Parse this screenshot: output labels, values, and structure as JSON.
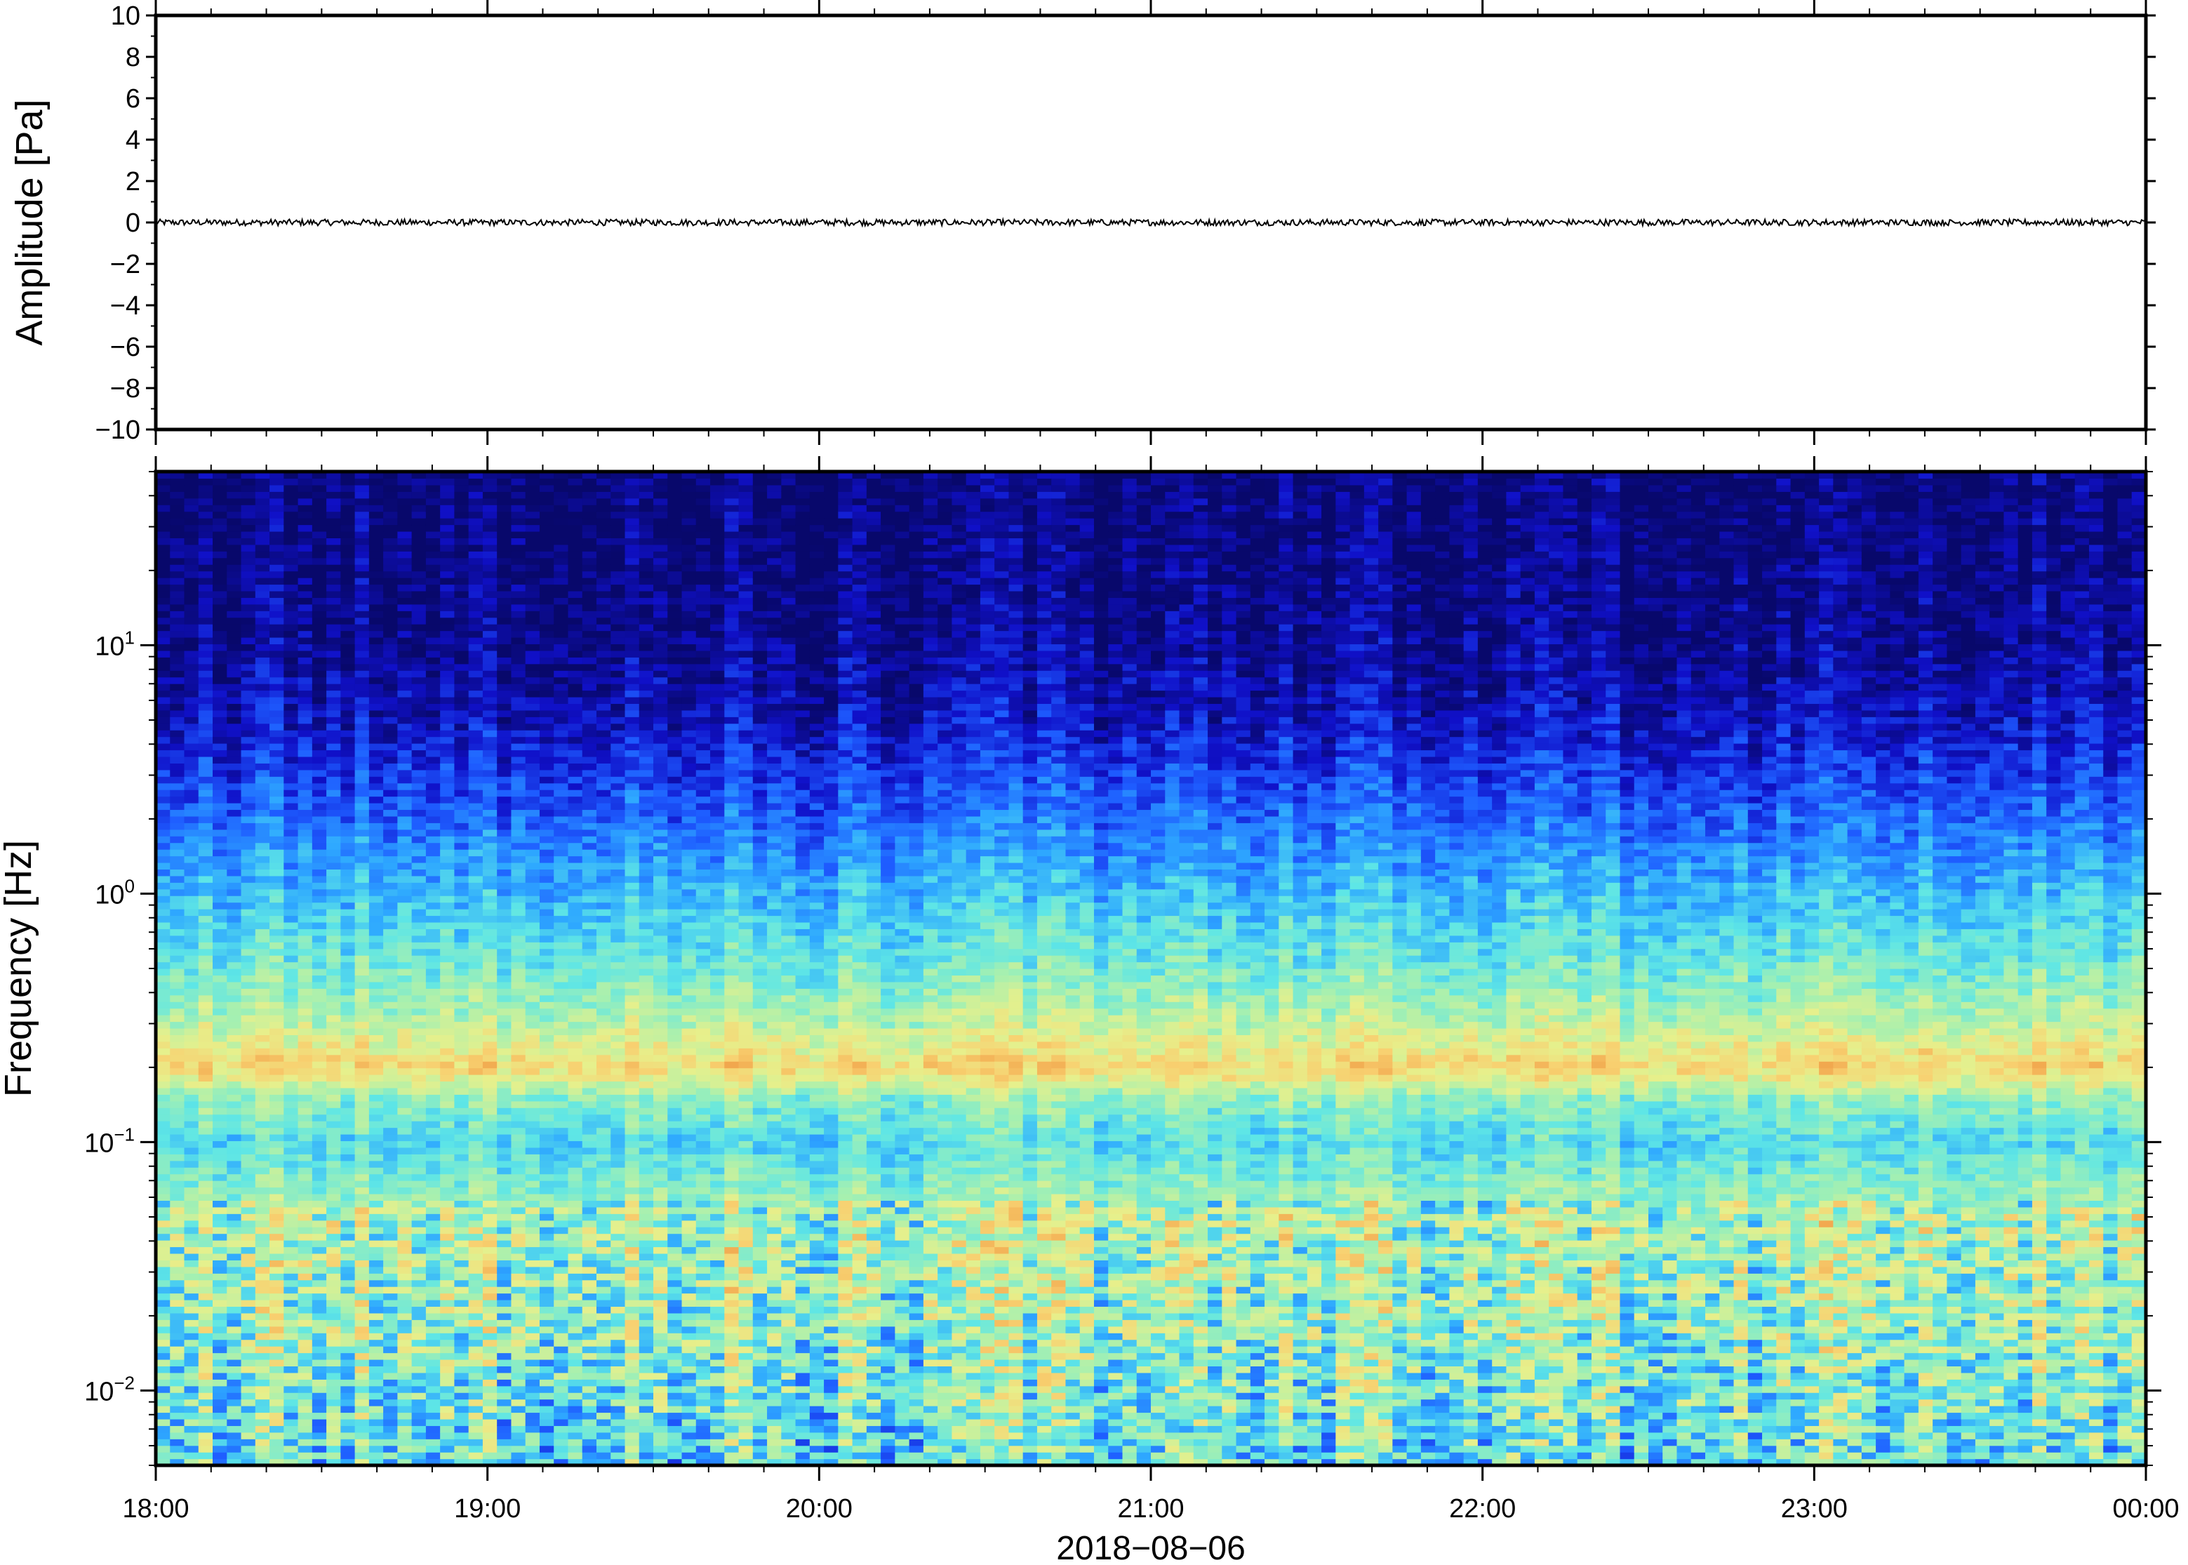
{
  "chart_data": [
    {
      "type": "line",
      "panel": "waveform",
      "title": "",
      "xlabel": "",
      "ylabel": "Amplitude [Pa]",
      "ylim": [
        -10,
        10
      ],
      "yticks": [
        10,
        8,
        6,
        4,
        2,
        0,
        -2,
        -4,
        -6,
        -8,
        -10
      ],
      "ytick_labels": [
        "10",
        "8",
        "6",
        "4",
        "2",
        "0",
        "−2",
        "−4",
        "−6",
        "−8",
        "−10"
      ],
      "x": [
        "18:00",
        "19:00",
        "20:00",
        "21:00",
        "22:00",
        "23:00",
        "00:00"
      ],
      "series": [
        {
          "values": [
            0,
            0,
            0,
            0,
            0,
            0,
            0
          ]
        }
      ],
      "noise_amplitude_pa": 0.15,
      "line_color": "#000000",
      "grid": false
    },
    {
      "type": "heatmap",
      "panel": "spectrogram",
      "title": "",
      "ylabel": "Frequency [Hz]",
      "yscale": "log",
      "ylim": [
        0.005,
        50
      ],
      "ytick_labels": [
        {
          "value": 10,
          "base": "10",
          "exp": "1"
        },
        {
          "value": 1,
          "base": "10",
          "exp": "0"
        },
        {
          "value": 0.1,
          "base": "10",
          "exp": "−1"
        },
        {
          "value": 0.01,
          "base": "10",
          "exp": "−2"
        }
      ],
      "x_tick_labels": [
        "18:00",
        "19:00",
        "20:00",
        "21:00",
        "22:00",
        "23:00",
        "00:00"
      ],
      "xlabel": "2018−08−06",
      "xlim_hours": [
        0,
        6
      ],
      "colormap": [
        "#08086b",
        "#1010c8",
        "#1e5cff",
        "#2ea8ff",
        "#5ee6e6",
        "#a6f0b0",
        "#e6f08c",
        "#f8d070",
        "#f0a048"
      ],
      "power_profile": [
        {
          "freq": 50,
          "level": 0.02
        },
        {
          "freq": 12,
          "level": 0.05
        },
        {
          "freq": 5,
          "level": 0.12
        },
        {
          "freq": 2,
          "level": 0.28
        },
        {
          "freq": 1,
          "level": 0.42
        },
        {
          "freq": 0.5,
          "level": 0.55
        },
        {
          "freq": 0.3,
          "level": 0.68
        },
        {
          "freq": 0.2,
          "level": 0.86
        },
        {
          "freq": 0.15,
          "level": 0.6
        },
        {
          "freq": 0.1,
          "level": 0.48
        },
        {
          "freq": 0.05,
          "level": 0.66
        },
        {
          "freq": 0.02,
          "level": 0.62
        },
        {
          "freq": 0.005,
          "level": 0.5
        }
      ],
      "grid": false
    }
  ]
}
